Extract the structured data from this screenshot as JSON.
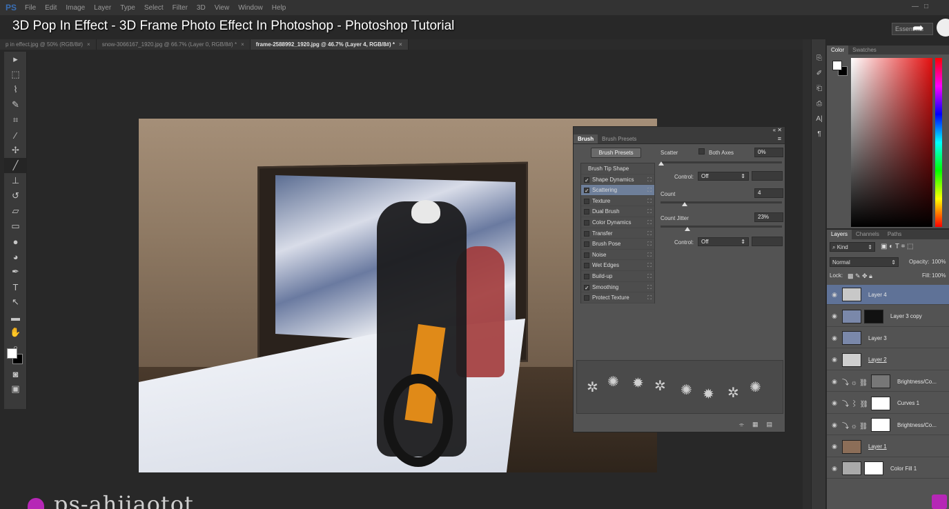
{
  "app": {
    "short_name": "PS"
  },
  "menu": [
    "File",
    "Edit",
    "Image",
    "Layer",
    "Type",
    "Select",
    "Filter",
    "3D",
    "View",
    "Window",
    "Help"
  ],
  "window_buttons": {
    "minimize": "—",
    "restore": "□"
  },
  "video_title": "3D Pop In Effect - 3D Frame Photo Effect In Photoshop - Photoshop Tutorial",
  "workspace": "Essentials",
  "tabs": [
    {
      "label": "p in effect.jpg @ 50% (RGB/8#)"
    },
    {
      "label": "snow-3066167_1920.jpg @ 66.7% (Layer 0, RGB/8#) *"
    },
    {
      "label": "frame-2588992_1920.jpg @ 46.7% (Layer 4, RGB/8#) *"
    }
  ],
  "tools": [
    "move-tool",
    "marquee-tool",
    "lasso-tool",
    "quick-selection-tool",
    "crop-tool",
    "eyedropper-tool",
    "spot-healing-tool",
    "brush-tool",
    "clone-stamp-tool",
    "history-brush-tool",
    "eraser-tool",
    "gradient-tool",
    "blur-tool",
    "dodge-tool",
    "pen-tool",
    "type-tool",
    "path-selection-tool",
    "rectangle-tool",
    "hand-tool",
    "zoom-tool"
  ],
  "tool_glyphs": [
    "▸",
    "⬚",
    "⌇",
    "✎",
    "⌗",
    "⁄",
    "✢",
    "╱",
    "⊥",
    "↺",
    "▱",
    "▭",
    "●",
    "◕",
    "✒",
    "T",
    "↖",
    "▬",
    "✋",
    "⌕"
  ],
  "brush_panel": {
    "tabs": [
      "Brush",
      "Brush Presets"
    ],
    "presets_button": "Brush Presets",
    "list_header": "Brush Tip Shape",
    "items": [
      {
        "label": "Shape Dynamics",
        "checked": true
      },
      {
        "label": "Scattering",
        "checked": true,
        "selected": true
      },
      {
        "label": "Texture",
        "checked": false
      },
      {
        "label": "Dual Brush",
        "checked": false
      },
      {
        "label": "Color Dynamics",
        "checked": false
      },
      {
        "label": "Transfer",
        "checked": false
      },
      {
        "label": "Brush Pose",
        "checked": false
      },
      {
        "label": "Noise",
        "checked": false
      },
      {
        "label": "Wet Edges",
        "checked": false
      },
      {
        "label": "Build-up",
        "checked": false
      },
      {
        "label": "Smoothing",
        "checked": true
      },
      {
        "label": "Protect Texture",
        "checked": false
      }
    ],
    "scatter_label": "Scatter",
    "both_axes_label": "Both Axes",
    "scatter_value": "0%",
    "control_label": "Control:",
    "control1_value": "Off",
    "count_label": "Count",
    "count_value": "4",
    "count_jitter_label": "Count Jitter",
    "count_jitter_value": "23%",
    "control2_value": "Off"
  },
  "color_panel": {
    "tabs": [
      "Color",
      "Swatches"
    ]
  },
  "layers_panel": {
    "tabs": [
      "Layers",
      "Channels",
      "Paths"
    ],
    "kind_label": "Kind",
    "blend_mode": "Normal",
    "opacity_label": "Opacity:",
    "opacity_value": "100%",
    "lock_label": "Lock:",
    "fill_label": "Fill:",
    "fill_value": "100%",
    "layers": [
      {
        "name": "Layer 4",
        "selected": true,
        "underlined": false,
        "thumb": "#c8c8c8",
        "mask": null,
        "adjust": null
      },
      {
        "name": "Layer 3 copy",
        "selected": false,
        "underlined": false,
        "thumb": "#7a88aa",
        "mask": "#111",
        "adjust": null
      },
      {
        "name": "Layer 3",
        "selected": false,
        "underlined": false,
        "thumb": "#7a88aa",
        "mask": null,
        "adjust": null
      },
      {
        "name": "Layer 2",
        "selected": false,
        "underlined": true,
        "thumb": "#cfcfcf",
        "mask": null,
        "adjust": null
      },
      {
        "name": "Brightness/Co...",
        "selected": false,
        "underlined": false,
        "thumb": null,
        "mask": "#777",
        "adjust": "☼"
      },
      {
        "name": "Curves 1",
        "selected": false,
        "underlined": false,
        "thumb": null,
        "mask": "#fff",
        "adjust": "⌇"
      },
      {
        "name": "Brightness/Co...",
        "selected": false,
        "underlined": false,
        "thumb": null,
        "mask": "#fff",
        "adjust": "☼"
      },
      {
        "name": "Layer 1",
        "selected": false,
        "underlined": true,
        "thumb": "#8c6e58",
        "mask": null,
        "adjust": null
      },
      {
        "name": "Color Fill 1",
        "selected": false,
        "underlined": false,
        "thumb": "#aaaaaa",
        "mask": "#fff",
        "adjust": null
      }
    ]
  },
  "watermark": "ps-ahjiaotot",
  "colors": {
    "accent": "#5f7297",
    "panel": "#535353",
    "logo": "#b627b6"
  }
}
